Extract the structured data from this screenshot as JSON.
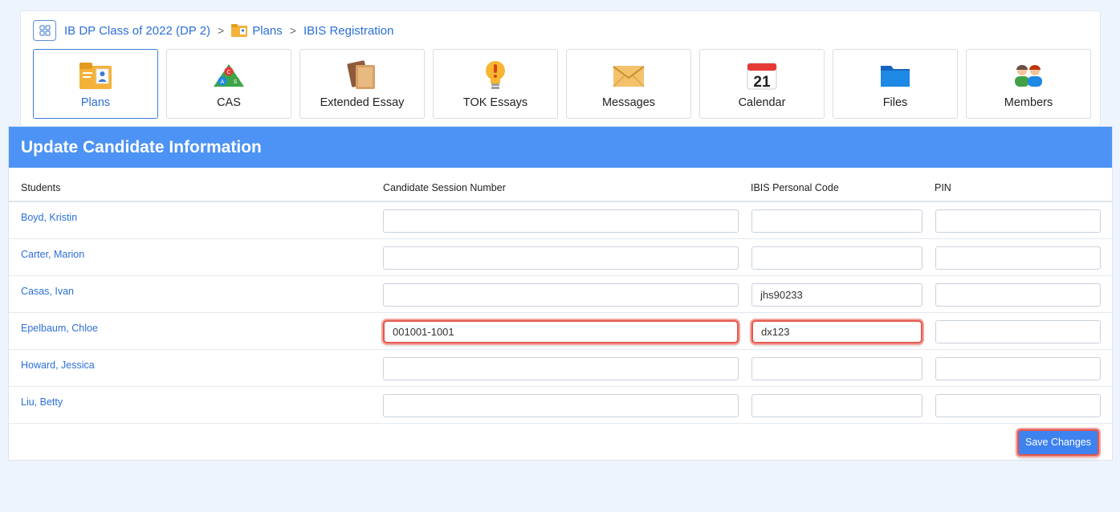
{
  "breadcrumb": {
    "class_name": "IB DP Class of 2022 (DP 2)",
    "plans": "Plans",
    "current": "IBIS Registration",
    "separator": ">"
  },
  "tabs": [
    {
      "label": "Plans",
      "icon": "plans-folder-icon",
      "active": true
    },
    {
      "label": "CAS",
      "icon": "cas-triangle-icon",
      "active": false
    },
    {
      "label": "Extended Essay",
      "icon": "books-icon",
      "active": false
    },
    {
      "label": "TOK Essays",
      "icon": "lightbulb-icon",
      "active": false
    },
    {
      "label": "Messages",
      "icon": "envelope-icon",
      "active": false
    },
    {
      "label": "Calendar",
      "icon": "calendar-icon",
      "active": false
    },
    {
      "label": "Files",
      "icon": "folder-icon",
      "active": false
    },
    {
      "label": "Members",
      "icon": "people-icon",
      "active": false
    }
  ],
  "calendar_day": "21",
  "cas_letters": [
    "C",
    "A",
    "S"
  ],
  "card": {
    "title": "Update Candidate Information",
    "columns": [
      "Students",
      "Candidate Session Number",
      "IBIS Personal Code",
      "PIN"
    ],
    "rows": [
      {
        "student": "Boyd, Kristin",
        "session_number": "",
        "personal_code": "",
        "pin": ""
      },
      {
        "student": "Carter, Marion",
        "session_number": "",
        "personal_code": "",
        "pin": ""
      },
      {
        "student": "Casas, Ivan",
        "session_number": "",
        "personal_code": "jhs90233",
        "pin": ""
      },
      {
        "student": "Epelbaum, Chloe",
        "session_number": "001001-1001",
        "personal_code": "dx123",
        "pin": ""
      },
      {
        "student": "Howard, Jessica",
        "session_number": "",
        "personal_code": "",
        "pin": ""
      },
      {
        "student": "Liu, Betty",
        "session_number": "",
        "personal_code": "",
        "pin": ""
      }
    ],
    "save_label": "Save Changes"
  },
  "colors": {
    "header_blue": "#4c93f5",
    "link_blue": "#2b6fd6",
    "highlight_red": "#e4574d"
  }
}
